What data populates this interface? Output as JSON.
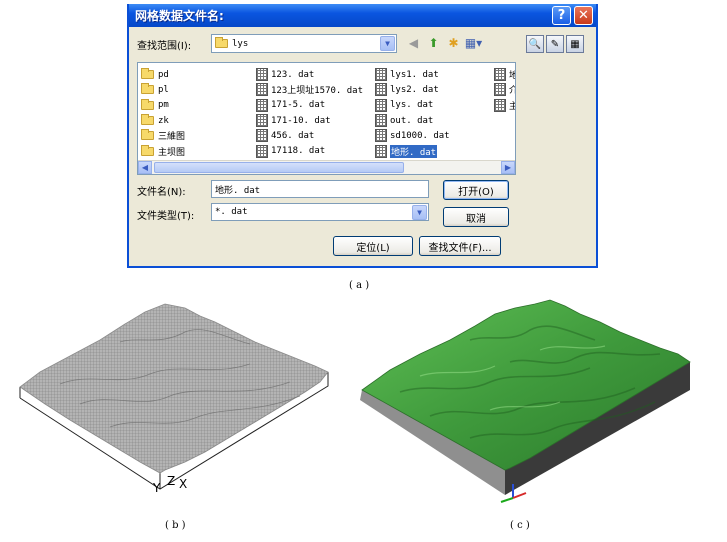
{
  "dialog": {
    "title": "网格数据文件名:",
    "help_label": "?",
    "close_label": "✕",
    "look_in_label": "查找范围(I):",
    "look_in_value": "lys",
    "file_columns": [
      [
        "pd",
        "pl",
        "pm",
        "zk",
        "三維图",
        "主坝图"
      ],
      [
        "123. dat",
        "123上坝址1570. dat",
        "171-5. dat",
        "171-10. dat",
        "456. dat",
        "17118. dat"
      ],
      [
        "lys1. dat",
        "lys2. dat",
        "lys. dat",
        "out. dat",
        "sd1000. dat",
        "地形. dat"
      ],
      [
        "地",
        "介",
        "主"
      ]
    ],
    "selected_file": "地形. dat",
    "file_name_label": "文件名(N):",
    "file_name_value": "地形. dat",
    "file_type_label": "文件类型(T):",
    "file_type_value": "*. dat",
    "open_button": "打开(O)",
    "cancel_button": "取消",
    "locate_button": "定位(L)",
    "find_button": "查找文件(F)..."
  },
  "captions": {
    "a": "( a )",
    "b": "( b )",
    "c": "( c )"
  },
  "axes_b": {
    "y": "Y",
    "z": "Z",
    "x": "X"
  },
  "colors": {
    "title_bar": "#0a55e0",
    "terrain_green": "#3f9a3c",
    "wireframe": "#9a9a9a",
    "selection": "#316ac5"
  },
  "icons": [
    "folder-icon",
    "back-icon",
    "up-folder-icon",
    "new-folder-icon",
    "views-icon",
    "search-icon",
    "tools-icon",
    "grid-file-icon"
  ]
}
